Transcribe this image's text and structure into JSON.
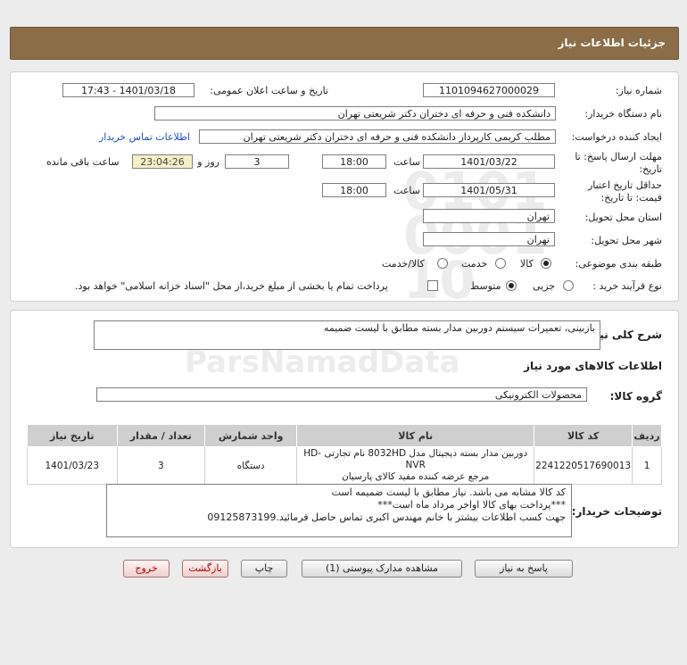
{
  "header": {
    "title": "جزئیات اطلاعات نیاز"
  },
  "info": {
    "need_number_label": "شماره نیاز:",
    "need_number": "1101094627000029",
    "announce_label": "تاریخ و ساعت اعلان عمومی:",
    "announce_value": "1401/03/18 - 17:43",
    "buyer_label": "نام دستگاه خریدار:",
    "buyer_value": "دانشکده فنی و حرفه ای دختران دکتر شریعتی تهران",
    "requester_label": "ایجاد کننده درخواست:",
    "requester_value": "مطلب کریمی کارپرداز دانشکده فنی و حرفه ای دختران دکتر شریعتی تهران",
    "contact_link": "اطلاعات تماس خریدار",
    "deadline_label_1": "مهلت ارسال پاسخ: تا",
    "deadline_label_2": "تاریخ:",
    "deadline_date": "1401/03/22",
    "time_label": "ساعت",
    "deadline_time": "18:00",
    "days_value": "3",
    "days_label": "روز و",
    "remaining_time": "23:04:26",
    "remaining_label": "ساعت باقی مانده",
    "validity_label_1": "حداقل تاریخ اعتبار",
    "validity_label_2": "قیمت: تا تاریخ:",
    "validity_date": "1401/05/31",
    "validity_time_label": "ساعت",
    "validity_time": "18:00",
    "province_label": "استان محل تحویل:",
    "province_value": "تهران",
    "city_label": "شهر محل تحویل:",
    "city_value": "تهران",
    "category_label": "طبقه بندی موضوعی:",
    "category_options": [
      "کالا",
      "خدمت",
      "کالا/خدمت"
    ],
    "process_label": "نوع فرآیند خرید :",
    "process_options": [
      "جزیی",
      "متوسط"
    ],
    "payment_note": "پرداخت تمام یا بخشی از مبلغ خرید،از محل \"اسناد خزانه اسلامی\" خواهد بود."
  },
  "details": {
    "summary_label": "شرح کلی نیاز:",
    "summary_value": "بازبینی، تعمیرات سیستم دوربین مدار بسته مطابق با لیست ضمیمه",
    "goods_title": "اطلاعات کالاهای مورد نیاز",
    "group_label": "گروه کالا:",
    "group_value": "محصولات الکترونیکی",
    "table": {
      "headers": [
        "ردیف",
        "کد کالا",
        "نام کالا",
        "واحد شمارش",
        "تعداد / مقدار",
        "تاریخ نیاز"
      ],
      "rows": [
        {
          "row": "1",
          "code": "2241220517690013",
          "name_line1": "دوربین مدار بسته دیجیتال مدل 8032HD نام تجارتی HD-NVR",
          "name_line2": "مرجع عرضه کننده مفید کالای پارسیان",
          "unit": "دستگاه",
          "qty": "3",
          "date": "1401/03/23"
        }
      ]
    },
    "notes_label": "توضیحات خریدار:",
    "notes_lines": [
      "کد کالا مشابه می باشد. نیاز مطابق با لیست ضمیمه است",
      "***پرداخت بهای کالا اواخر مرداد ماه است***",
      "جهت کسب اطلاعات بیشتر با خانم مهندس اکبری تماس حاصل فرمائید.09125873199"
    ]
  },
  "buttons": {
    "reply": "پاسخ به نیاز",
    "attachments": "مشاهده مدارک پیوستی (1)",
    "print": "چاپ",
    "back": "بازگشت",
    "exit": "خروج"
  }
}
